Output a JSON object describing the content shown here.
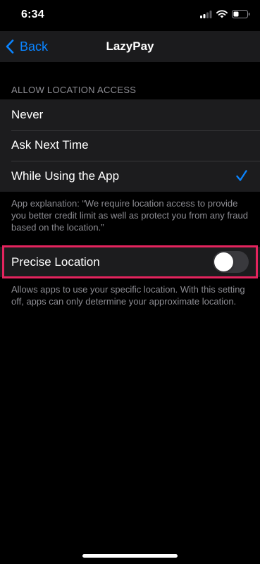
{
  "status_bar": {
    "time": "6:34",
    "icons": [
      "signal-icon",
      "wifi-icon",
      "battery-icon"
    ]
  },
  "nav": {
    "back_label": "Back",
    "title": "LazyPay"
  },
  "location_section": {
    "header": "ALLOW LOCATION ACCESS",
    "options": [
      {
        "label": "Never",
        "selected": false
      },
      {
        "label": "Ask Next Time",
        "selected": false
      },
      {
        "label": "While Using the App",
        "selected": true
      }
    ],
    "explanation": "App explanation: “We require location access to provide you better credit limit as well as protect you from any fraud based on the location.”"
  },
  "precise_location": {
    "label": "Precise Location",
    "enabled": false,
    "description": "Allows apps to use your specific location. With this setting off, apps can only determine your approximate location."
  },
  "colors": {
    "accent": "#0a84ff",
    "highlight": "#e4245e",
    "background": "#000000",
    "group_background": "#1c1c1e"
  }
}
